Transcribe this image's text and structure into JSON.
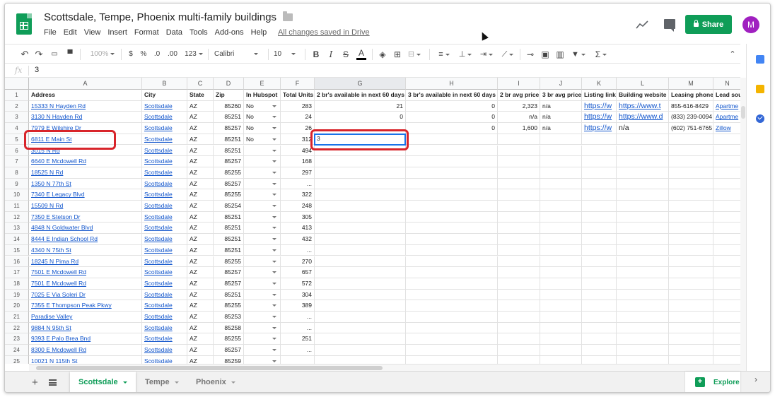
{
  "document": {
    "title": "Scottsdale, Tempe, Phoenix multi-family buildings",
    "save_status": "All changes saved in Drive"
  },
  "menu": [
    "File",
    "Edit",
    "View",
    "Insert",
    "Format",
    "Data",
    "Tools",
    "Add-ons",
    "Help"
  ],
  "header": {
    "share_label": "Share",
    "avatar_initial": "M"
  },
  "toolbar": {
    "zoom": "100%",
    "currency": "$",
    "percent": "%",
    "decrease_decimals": ".0",
    "increase_decimals": ".00",
    "more_formats": "123",
    "font": "Calibri",
    "font_size": "10",
    "bold": "B",
    "italic": "I",
    "strike": "S",
    "text_color": "A",
    "sum": "Σ"
  },
  "formula_bar": {
    "fx": "fx",
    "value": "3"
  },
  "columns": [
    {
      "letter": "A",
      "header": "Address"
    },
    {
      "letter": "B",
      "header": "City"
    },
    {
      "letter": "C",
      "header": "State"
    },
    {
      "letter": "D",
      "header": "Zip"
    },
    {
      "letter": "E",
      "header": "In Hubspot"
    },
    {
      "letter": "F",
      "header": "Total Units"
    },
    {
      "letter": "G",
      "header": "2 br's available in next 60 days"
    },
    {
      "letter": "H",
      "header": "3 br's available in next 60 days"
    },
    {
      "letter": "I",
      "header": "2 br avg price"
    },
    {
      "letter": "J",
      "header": "3 br avg price"
    },
    {
      "letter": "K",
      "header": "Listing link"
    },
    {
      "letter": "L",
      "header": "Building website"
    },
    {
      "letter": "M",
      "header": "Leasing phone"
    },
    {
      "letter": "N",
      "header": "Lead sou"
    }
  ],
  "rows": [
    [
      "15333 N Hayden Rd",
      "Scottsdale",
      "AZ",
      "85260",
      "No",
      "283",
      "21",
      "0",
      "2,323",
      "n/a",
      "https://w",
      "https://www.t",
      "855-616-8429",
      "Apartme"
    ],
    [
      "3130 N Hayden Rd",
      "Scottsdale",
      "AZ",
      "85251",
      "No",
      "24",
      "0",
      "0",
      "n/a",
      "n/a",
      "https://w",
      "https://www.d",
      "(833) 239-0094",
      "Apartme"
    ],
    [
      "7979 E Wilshire Dr",
      "Scottsdale",
      "AZ",
      "85257",
      "No",
      "26",
      "",
      "0",
      "1,600",
      "n/a",
      "https://w",
      "n/a",
      "(602) 751-6765",
      "Zillow"
    ],
    [
      "6811 E Main St",
      "Scottsdale",
      "AZ",
      "85251",
      "No",
      "312",
      "",
      "",
      "",
      "",
      "",
      "",
      "",
      ""
    ],
    [
      "3015 N  Rd",
      "Scottsdale",
      "AZ",
      "85251",
      "",
      "494",
      "",
      "",
      "",
      "",
      "",
      "",
      "",
      ""
    ],
    [
      "6640 E Mcdowell Rd",
      "Scottsdale",
      "AZ",
      "85257",
      "",
      "168",
      "",
      "",
      "",
      "",
      "",
      "",
      "",
      ""
    ],
    [
      "18525 N  Rd",
      "Scottsdale",
      "AZ",
      "85255",
      "",
      "297",
      "",
      "",
      "",
      "",
      "",
      "",
      "",
      ""
    ],
    [
      "1350 N 77th St",
      "Scottsdale",
      "AZ",
      "85257",
      "",
      "...",
      "",
      "",
      "",
      "",
      "",
      "",
      "",
      ""
    ],
    [
      "7340 E Legacy Blvd",
      "Scottsdale",
      "AZ",
      "85255",
      "",
      "322",
      "",
      "",
      "",
      "",
      "",
      "",
      "",
      ""
    ],
    [
      "15509 N  Rd",
      "Scottsdale",
      "AZ",
      "85254",
      "",
      "248",
      "",
      "",
      "",
      "",
      "",
      "",
      "",
      ""
    ],
    [
      "7350 E Stetson Dr",
      "Scottsdale",
      "AZ",
      "85251",
      "",
      "305",
      "",
      "",
      "",
      "",
      "",
      "",
      "",
      ""
    ],
    [
      "4848 N Goldwater Blvd",
      "Scottsdale",
      "AZ",
      "85251",
      "",
      "413",
      "",
      "",
      "",
      "",
      "",
      "",
      "",
      ""
    ],
    [
      "8444 E Indian School Rd",
      "Scottsdale",
      "AZ",
      "85251",
      "",
      "432",
      "",
      "",
      "",
      "",
      "",
      "",
      "",
      ""
    ],
    [
      "4340 N 75th St",
      "Scottsdale",
      "AZ",
      "85251",
      "",
      "...",
      "",
      "",
      "",
      "",
      "",
      "",
      "",
      ""
    ],
    [
      "18245 N Pima Rd",
      "Scottsdale",
      "AZ",
      "85255",
      "",
      "270",
      "",
      "",
      "",
      "",
      "",
      "",
      "",
      ""
    ],
    [
      "7501 E Mcdowell Rd",
      "Scottsdale",
      "AZ",
      "85257",
      "",
      "657",
      "",
      "",
      "",
      "",
      "",
      "",
      "",
      ""
    ],
    [
      "7501 E Mcdowell Rd",
      "Scottsdale",
      "AZ",
      "85257",
      "",
      "572",
      "",
      "",
      "",
      "",
      "",
      "",
      "",
      ""
    ],
    [
      "7025 E Via Soleri Dr",
      "Scottsdale",
      "AZ",
      "85251",
      "",
      "304",
      "",
      "",
      "",
      "",
      "",
      "",
      "",
      ""
    ],
    [
      "7355 E Thompson Peak Pkwy",
      "Scottsdale",
      "AZ",
      "85255",
      "",
      "389",
      "",
      "",
      "",
      "",
      "",
      "",
      "",
      ""
    ],
    [
      "Paradise Valley",
      "Scottsdale",
      "AZ",
      "85253",
      "",
      "...",
      "",
      "",
      "",
      "",
      "",
      "",
      "",
      ""
    ],
    [
      "9884 N 95th St",
      "Scottsdale",
      "AZ",
      "85258",
      "",
      "...",
      "",
      "",
      "",
      "",
      "",
      "",
      "",
      ""
    ],
    [
      "9393 E Palo Brea Bnd",
      "Scottsdale",
      "AZ",
      "85255",
      "",
      "251",
      "",
      "",
      "",
      "",
      "",
      "",
      "",
      ""
    ],
    [
      "8300 E Mcdowell Rd",
      "Scottsdale",
      "AZ",
      "85257",
      "",
      "...",
      "",
      "",
      "",
      "",
      "",
      "",
      "",
      ""
    ],
    [
      "10021 N 115th St",
      "Scottsdale",
      "AZ",
      "85259",
      "",
      "",
      "",
      "",
      "",
      "",
      "",
      "",
      "",
      ""
    ]
  ],
  "active_cell": {
    "value": "3"
  },
  "sheets": [
    {
      "label": "Scottsdale",
      "active": true
    },
    {
      "label": "Tempe",
      "active": false
    },
    {
      "label": "Phoenix",
      "active": false
    }
  ],
  "explore_label": "Explore",
  "colors": {
    "green": "#0f9d58",
    "link": "#1155cc",
    "highlight": "#d8242a",
    "selection": "#1a73e8"
  }
}
